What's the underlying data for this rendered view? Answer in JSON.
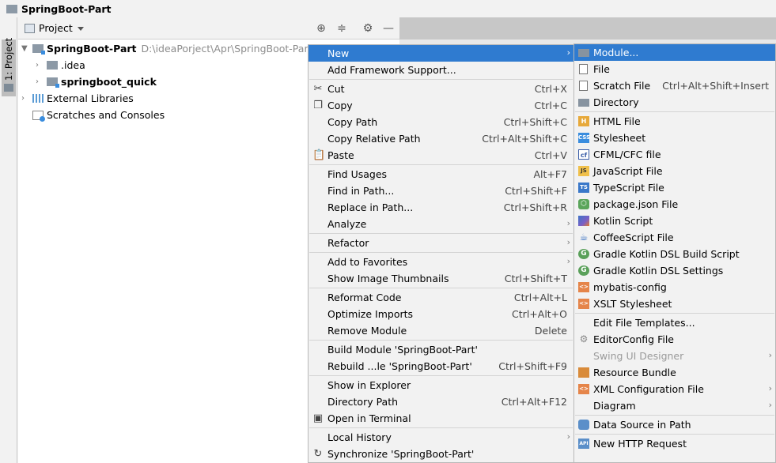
{
  "window": {
    "title": "SpringBoot-Part"
  },
  "tool_strip": {
    "label": "1: Project"
  },
  "project_panel": {
    "title": "Project",
    "tree": [
      {
        "name": "SpringBoot-Part",
        "path": "D:\\ideaPorject\\Apr\\SpringBoot-Part"
      },
      {
        "name": ".idea"
      },
      {
        "name": "springboot_quick"
      },
      {
        "name": "External Libraries"
      },
      {
        "name": "Scratches and Consoles"
      }
    ]
  },
  "context_menu": {
    "items": [
      {
        "label": "New",
        "shortcut": ""
      },
      {
        "label": "Add Framework Support...",
        "shortcut": ""
      },
      {
        "label": "Cut",
        "shortcut": "Ctrl+X"
      },
      {
        "label": "Copy",
        "shortcut": "Ctrl+C"
      },
      {
        "label": "Copy Path",
        "shortcut": "Ctrl+Shift+C"
      },
      {
        "label": "Copy Relative Path",
        "shortcut": "Ctrl+Alt+Shift+C"
      },
      {
        "label": "Paste",
        "shortcut": "Ctrl+V"
      },
      {
        "label": "Find Usages",
        "shortcut": "Alt+F7"
      },
      {
        "label": "Find in Path...",
        "shortcut": "Ctrl+Shift+F"
      },
      {
        "label": "Replace in Path...",
        "shortcut": "Ctrl+Shift+R"
      },
      {
        "label": "Analyze",
        "shortcut": ""
      },
      {
        "label": "Refactor",
        "shortcut": ""
      },
      {
        "label": "Add to Favorites",
        "shortcut": ""
      },
      {
        "label": "Show Image Thumbnails",
        "shortcut": "Ctrl+Shift+T"
      },
      {
        "label": "Reformat Code",
        "shortcut": "Ctrl+Alt+L"
      },
      {
        "label": "Optimize Imports",
        "shortcut": "Ctrl+Alt+O"
      },
      {
        "label": "Remove Module",
        "shortcut": "Delete"
      },
      {
        "label": "Build Module 'SpringBoot-Part'",
        "shortcut": ""
      },
      {
        "label": "Rebuild ...le 'SpringBoot-Part'",
        "shortcut": "Ctrl+Shift+F9"
      },
      {
        "label": "Show in Explorer",
        "shortcut": ""
      },
      {
        "label": "Directory Path",
        "shortcut": "Ctrl+Alt+F12"
      },
      {
        "label": "Open in Terminal",
        "shortcut": ""
      },
      {
        "label": "Local History",
        "shortcut": ""
      },
      {
        "label": "Synchronize 'SpringBoot-Part'",
        "shortcut": ""
      }
    ]
  },
  "new_submenu": {
    "items": [
      {
        "label": "Module...",
        "shortcut": ""
      },
      {
        "label": "File",
        "shortcut": ""
      },
      {
        "label": "Scratch File",
        "shortcut": "Ctrl+Alt+Shift+Insert"
      },
      {
        "label": "Directory",
        "shortcut": ""
      },
      {
        "label": "HTML File",
        "shortcut": ""
      },
      {
        "label": "Stylesheet",
        "shortcut": ""
      },
      {
        "label": "CFML/CFC file",
        "shortcut": ""
      },
      {
        "label": "JavaScript File",
        "shortcut": ""
      },
      {
        "label": "TypeScript File",
        "shortcut": ""
      },
      {
        "label": "package.json File",
        "shortcut": ""
      },
      {
        "label": "Kotlin Script",
        "shortcut": ""
      },
      {
        "label": "CoffeeScript File",
        "shortcut": ""
      },
      {
        "label": "Gradle Kotlin DSL Build Script",
        "shortcut": ""
      },
      {
        "label": "Gradle Kotlin DSL Settings",
        "shortcut": ""
      },
      {
        "label": "mybatis-config",
        "shortcut": ""
      },
      {
        "label": "XSLT Stylesheet",
        "shortcut": ""
      },
      {
        "label": "Edit File Templates...",
        "shortcut": ""
      },
      {
        "label": "EditorConfig File",
        "shortcut": ""
      },
      {
        "label": "Swing UI Designer",
        "shortcut": ""
      },
      {
        "label": "Resource Bundle",
        "shortcut": ""
      },
      {
        "label": "XML Configuration File",
        "shortcut": ""
      },
      {
        "label": "Diagram",
        "shortcut": ""
      },
      {
        "label": "Data Source in Path",
        "shortcut": ""
      },
      {
        "label": "New HTTP Request",
        "shortcut": ""
      }
    ]
  },
  "colors": {
    "selection": "#2f7bd0",
    "menu_bg": "#f2f2f2"
  }
}
